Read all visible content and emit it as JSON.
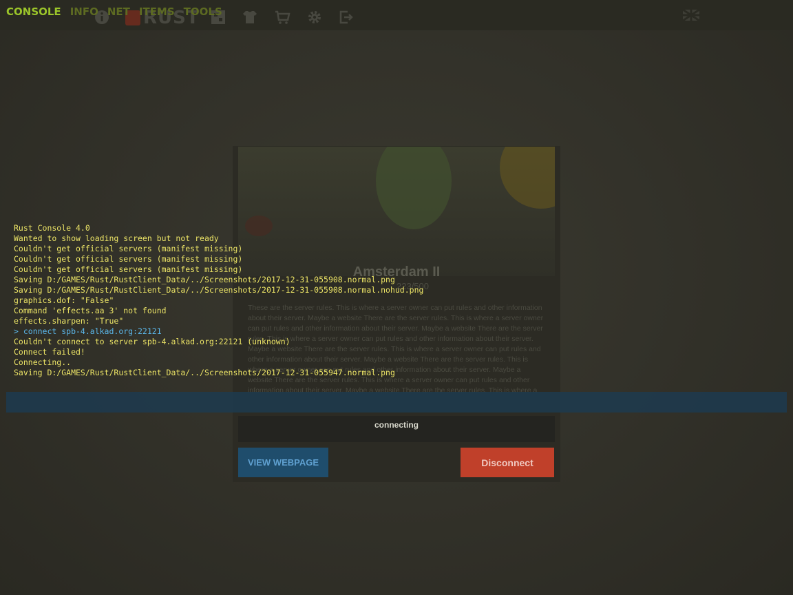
{
  "header": {
    "logo_text": "RUST",
    "nav_icons": [
      "info-icon",
      "rust-logo",
      "map-icon",
      "shirt-icon",
      "store-icon",
      "gear-icon",
      "exit-icon",
      "flag-icon"
    ]
  },
  "console": {
    "tabs": [
      "CONSOLE",
      "INFO",
      "NET",
      "ITEMS",
      "TOOLS"
    ],
    "active_tab": "CONSOLE",
    "lines": [
      {
        "text": "Rust Console 4.0",
        "kind": "log"
      },
      {
        "text": "Wanted to show loading screen but not ready",
        "kind": "log"
      },
      {
        "text": "Couldn't get official servers (manifest missing)",
        "kind": "log"
      },
      {
        "text": "Couldn't get official servers (manifest missing)",
        "kind": "log"
      },
      {
        "text": "Couldn't get official servers (manifest missing)",
        "kind": "log"
      },
      {
        "text": "Saving D:/GAMES/Rust/RustClient_Data/../Screenshots/2017-12-31-055908.normal.png",
        "kind": "log"
      },
      {
        "text": "Saving D:/GAMES/Rust/RustClient_Data/../Screenshots/2017-12-31-055908.normal.nohud.png",
        "kind": "log"
      },
      {
        "text": "graphics.dof: \"False\"",
        "kind": "log"
      },
      {
        "text": "Command 'effects.aa 3' not found",
        "kind": "log"
      },
      {
        "text": "effects.sharpen: \"True\"",
        "kind": "log"
      },
      {
        "text": "> connect spb-4.alkad.org:22121",
        "kind": "cmd"
      },
      {
        "text": "Couldn't connect to server spb-4.alkad.org:22121 (unknown)",
        "kind": "log"
      },
      {
        "text": "Connect failed!",
        "kind": "log"
      },
      {
        "text": "Connecting..",
        "kind": "log"
      },
      {
        "text": "Saving D:/GAMES/Rust/RustClient_Data/../Screenshots/2017-12-31-055947.normal.png",
        "kind": "log"
      }
    ],
    "input_value": ""
  },
  "server": {
    "name": "Amsterdam II",
    "players": "223/500",
    "description": "These are the server rules. This is where a server owner can put rules and other information about their server. Maybe a website There are the server rules. This is where a server owner can put rules and other information about their server. Maybe a website There are the server rules. This is where a server owner can put rules and other information about their server. Maybe a website There are the server rules. This is where a server owner can put rules and other information about their server. Maybe a website There are the server rules. This is where a server owner can put rules and other information about their server. Maybe a website There are the server rules. This is where a server owner can put rules and other information about their server. Maybe a website There are the server rules. This is where a server owner can put",
    "status": "connecting",
    "view_webpage_label": "VIEW WEBPAGE",
    "disconnect_label": "Disconnect"
  },
  "colors": {
    "console_text": "#ece466",
    "console_cmd": "#5bb7ea",
    "active_tab": "#9bc52a",
    "disconnect": "#c0402a",
    "webpage_button": "#1f4d6c"
  }
}
